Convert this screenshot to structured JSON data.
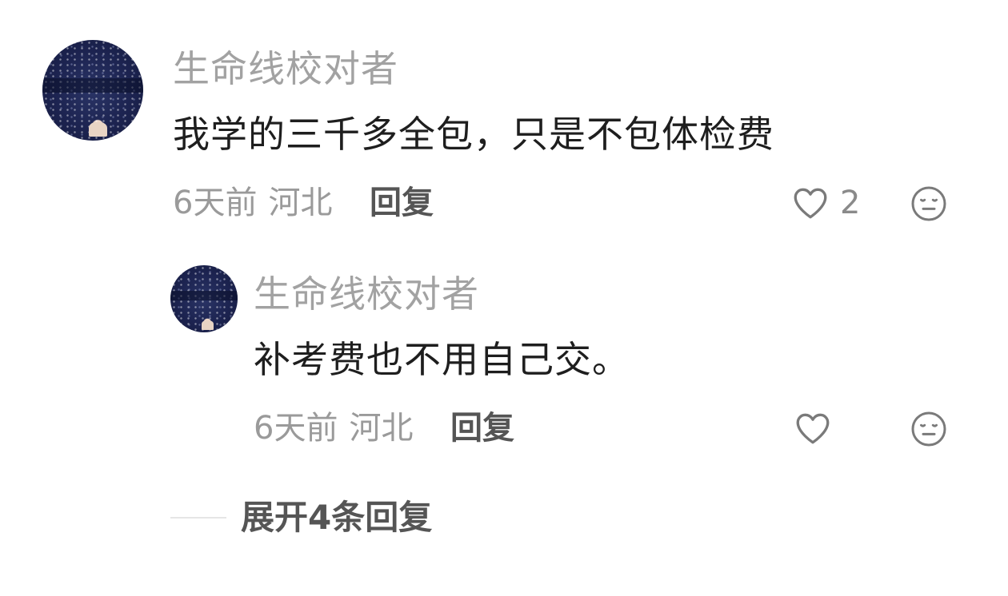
{
  "comment": {
    "username": "生命线校对者",
    "text": "我学的三千多全包，只是不包体检费",
    "time": "6天前",
    "location": "河北",
    "reply_label": "回复",
    "like_count": "2",
    "avatar_icon": "avatar-concert-crowd",
    "like_icon": "heart-outline-icon",
    "dislike_icon": "meh-face-icon"
  },
  "reply": {
    "username": "生命线校对者",
    "text": "补考费也不用自己交。",
    "time": "6天前",
    "location": "河北",
    "reply_label": "回复",
    "avatar_icon": "avatar-concert-crowd",
    "like_icon": "heart-outline-icon",
    "dislike_icon": "meh-face-icon"
  },
  "expand_replies": {
    "label": "展开4条回复"
  },
  "colors": {
    "username": "#a2a2a2",
    "text": "#1e1e1e",
    "meta": "#9a9a9a",
    "action": "#555555",
    "icon": "#7a7a7a"
  }
}
